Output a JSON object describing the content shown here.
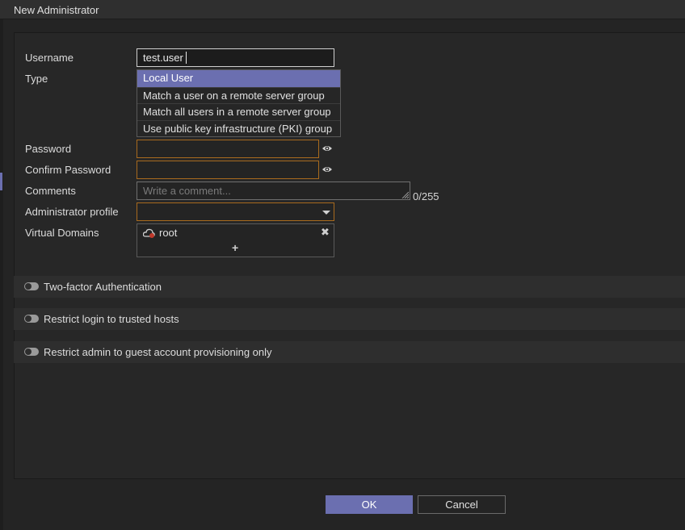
{
  "window": {
    "title": "New Administrator"
  },
  "form": {
    "username_label": "Username",
    "username_value": "test.user",
    "type_label": "Type",
    "type_options": [
      "Local User",
      "Match a user on a remote server group",
      "Match all users in a remote server group",
      "Use public key infrastructure (PKI) group"
    ],
    "password_label": "Password",
    "confirm_password_label": "Confirm Password",
    "comments_label": "Comments",
    "comments_placeholder": "Write a comment...",
    "comments_count": "0/255",
    "admin_profile_label": "Administrator profile",
    "virtual_domains_label": "Virtual Domains",
    "virtual_domain_item": "root",
    "add_symbol": "+",
    "remove_symbol": "✖"
  },
  "sections": {
    "two_factor": "Two-factor Authentication",
    "trusted_hosts": "Restrict login to trusted hosts",
    "guest_provisioning": "Restrict admin to guest account provisioning only"
  },
  "buttons": {
    "ok": "OK",
    "cancel": "Cancel"
  },
  "colors": {
    "accent": "#6b6fb0",
    "required_border": "#a86a1e",
    "background": "#242424"
  },
  "icons": {
    "eye": "eye-icon",
    "dropdown": "chevron-down-icon",
    "vdom": "vdom-cloud-icon",
    "remove": "close-icon",
    "add": "plus-icon"
  }
}
